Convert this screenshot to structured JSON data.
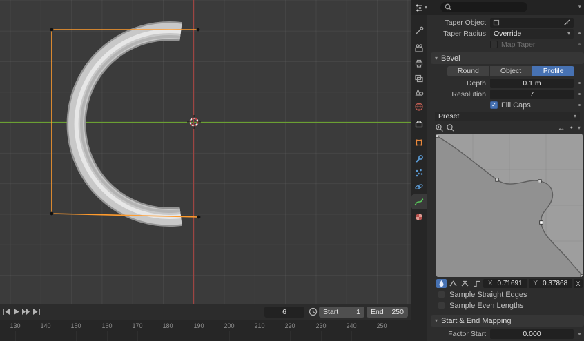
{
  "glyphs": {
    "chevron_down": "▾",
    "arrow_h": "↔",
    "dot": "●"
  },
  "colors": {
    "accent_blue": "#4772b3",
    "selection_orange": "#ff9b2d",
    "axis_green": "#6b9f33",
    "axis_red": "#9e4542"
  },
  "viewport": {
    "timeline": {
      "current_frame": "6",
      "start_label": "Start",
      "start_value": "1",
      "end_label": "End",
      "end_value": "250",
      "ruler": [
        "130",
        "140",
        "150",
        "160",
        "170",
        "180",
        "190",
        "200",
        "210",
        "220",
        "230",
        "240",
        "250"
      ]
    }
  },
  "tabs": {
    "titles": [
      "Tool",
      "Render",
      "Output",
      "View Layer",
      "Scene",
      "World",
      "Collection",
      "Object",
      "Modifiers",
      "Particles",
      "Physics",
      "Object Data",
      "Material"
    ]
  },
  "panel": {
    "taper_object_label": "Taper Object",
    "taper_radius_label": "Taper Radius",
    "taper_radius_value": "Override",
    "map_taper_label": "Map Taper",
    "bevel": {
      "title": "Bevel",
      "seg_tabs": [
        "Round",
        "Object",
        "Profile"
      ],
      "active_tab": "Profile",
      "depth_label": "Depth",
      "depth_value": "0.1 m",
      "resolution_label": "Resolution",
      "resolution_value": "7",
      "fill_caps_label": "Fill Caps",
      "check_glyph": "✓",
      "preset_label": "Preset",
      "point_x_label": "X",
      "point_x_value": "0.71691",
      "point_y_label": "Y",
      "point_y_value": "0.37868",
      "delete_label": "X",
      "sample_straight_label": "Sample Straight Edges",
      "sample_even_label": "Sample Even Lengths"
    },
    "mapping": {
      "title": "Start & End Mapping",
      "factor_start_label": "Factor Start",
      "factor_start_value": "0.000"
    }
  }
}
